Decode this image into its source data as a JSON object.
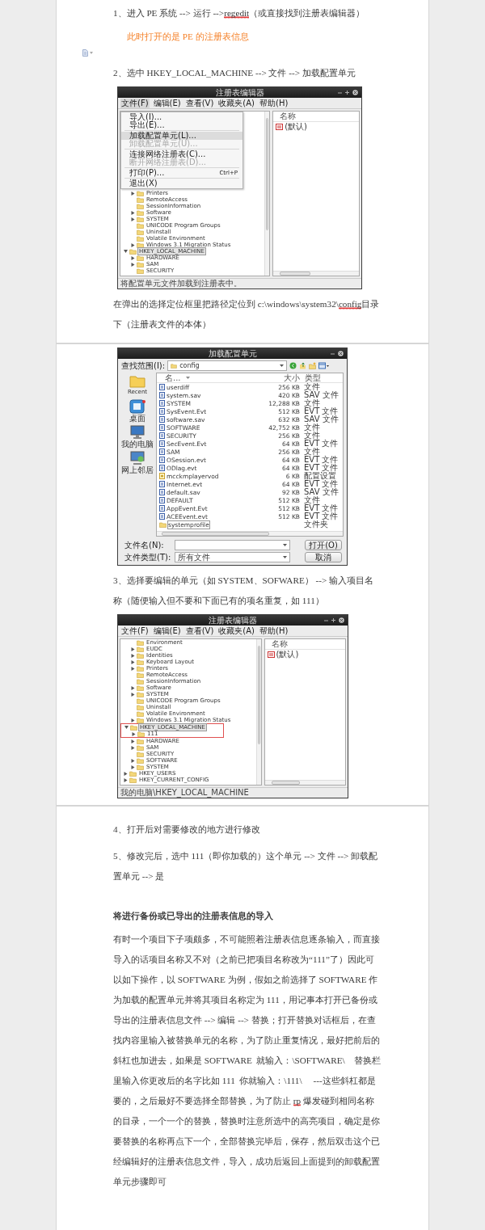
{
  "pages": [
    {
      "blocks": [
        {
          "kind": "paragraph",
          "segments": [
            {
              "text": "1、进入 PE 系统 --> 运行 -->",
              "flagged": false
            },
            {
              "text": "regedit",
              "flagged": true
            },
            {
              "text": "（或直接找到注册表编辑器）",
              "flagged": false
            }
          ]
        },
        {
          "kind": "note",
          "text": "此时打开的是 PE 的注册表信息"
        },
        {
          "kind": "anchor"
        },
        {
          "kind": "paragraph",
          "segments": [
            {
              "text": "2、选中 HKEY_LOCAL_MACHINE --> 文件 --> 加载配置单元",
              "flagged": false
            }
          ]
        },
        {
          "kind": "registry_editor",
          "title": "注册表编辑器",
          "menu": [
            {
              "label": "文件(F)",
              "selected": true
            },
            {
              "label": "编辑(E)",
              "selected": false
            },
            {
              "label": "查看(V)",
              "selected": false
            },
            {
              "label": "收藏夹(A)",
              "selected": false
            },
            {
              "label": "帮助(H)",
              "selected": false
            }
          ],
          "open_menu": [
            {
              "kind": "item",
              "label": "导入(I)...",
              "selected": false,
              "disabled": false
            },
            {
              "kind": "item",
              "label": "导出(E)...",
              "selected": false,
              "disabled": false
            },
            {
              "kind": "separator"
            },
            {
              "kind": "item",
              "label": "加载配置单元(L)...",
              "selected": true,
              "disabled": false
            },
            {
              "kind": "item",
              "label": "卸载配置单元(U)...",
              "selected": false,
              "disabled": true
            },
            {
              "kind": "separator"
            },
            {
              "kind": "item",
              "label": "连接网络注册表(C)...",
              "selected": false,
              "disabled": false
            },
            {
              "kind": "item",
              "label": "断开网络注册表(D)...",
              "selected": false,
              "disabled": true
            },
            {
              "kind": "separator"
            },
            {
              "kind": "item",
              "label": "打印(P)...",
              "shortcut": "Ctrl+P",
              "selected": false,
              "disabled": false
            },
            {
              "kind": "separator"
            },
            {
              "kind": "item",
              "label": "退出(X)",
              "selected": false,
              "disabled": false
            }
          ],
          "tree": [
            {
              "children": [
                {
                  "label": "Printers",
                  "expandable": true,
                  "expanded": false,
                  "selected": false
                },
                {
                  "label": "RemoteAccess",
                  "expandable": false,
                  "selected": false
                },
                {
                  "label": "SessionInformation",
                  "expandable": false,
                  "selected": false
                },
                {
                  "label": "Software",
                  "expandable": true,
                  "expanded": false,
                  "selected": false
                },
                {
                  "label": "SYSTEM",
                  "expandable": true,
                  "expanded": false,
                  "selected": false
                },
                {
                  "label": "UNICODE Program Groups",
                  "expandable": false,
                  "selected": false
                },
                {
                  "label": "Uninstall",
                  "expandable": false,
                  "selected": false
                },
                {
                  "label": "Volatile Environment",
                  "expandable": false,
                  "selected": false
                },
                {
                  "label": "Windows 3.1 Migration Status",
                  "expandable": true,
                  "expanded": false,
                  "selected": false
                }
              ]
            },
            {
              "label": "HKEY_LOCAL_MACHINE",
              "expandable": true,
              "expanded": true,
              "selected": true,
              "children": [
                {
                  "label": "HARDWARE",
                  "expandable": true,
                  "expanded": false,
                  "selected": false
                },
                {
                  "label": "SAM",
                  "expandable": true,
                  "expanded": false,
                  "selected": false
                },
                {
                  "label": "SECURITY",
                  "expandable": false,
                  "selected": false
                }
              ]
            }
          ],
          "value_header": "名称",
          "values": [
            "(默认)"
          ],
          "status": "将配置单元文件加载到注册表中。"
        },
        {
          "kind": "paragraph",
          "segments": [
            {
              "text": "在弹出的选择定位框里把路径定位到 c:\\windows\\system32\\",
              "flagged": false
            },
            {
              "text": "config",
              "flagged": true
            },
            {
              "text": "目录下（注册表文件的本体）",
              "flagged": false
            }
          ]
        }
      ]
    },
    {
      "blocks": [
        {
          "kind": "open_dialog",
          "title": "加载配置单元",
          "look_in_label": "查找范围(I):",
          "look_in": "config",
          "places": [
            {
              "kind": "recent",
              "label": "Recent"
            },
            {
              "kind": "desktop",
              "label": "桌面"
            },
            {
              "kind": "computer",
              "label": "我的电脑"
            },
            {
              "kind": "network",
              "label": "网上邻居"
            }
          ],
          "columns": [
            "名...",
            "大小",
            "类型"
          ],
          "files": [
            {
              "kind": "file",
              "name": "userdiff",
              "size": "256 KB",
              "type": "文件",
              "selected": false
            },
            {
              "kind": "file",
              "name": "system.sav",
              "size": "420 KB",
              "type": "SAV 文件",
              "selected": false
            },
            {
              "kind": "file",
              "name": "SYSTEM",
              "size": "12,288 KB",
              "type": "文件",
              "selected": false
            },
            {
              "kind": "file",
              "name": "SysEvent.Evt",
              "size": "512 KB",
              "type": "EVT 文件",
              "selected": false
            },
            {
              "kind": "file",
              "name": "software.sav",
              "size": "632 KB",
              "type": "SAV 文件",
              "selected": false
            },
            {
              "kind": "file",
              "name": "SOFTWARE",
              "size": "42,752 KB",
              "type": "文件",
              "selected": false
            },
            {
              "kind": "file",
              "name": "SECURITY",
              "size": "256 KB",
              "type": "文件",
              "selected": false
            },
            {
              "kind": "file",
              "name": "SecEvent.Evt",
              "size": "64 KB",
              "type": "EVT 文件",
              "selected": false
            },
            {
              "kind": "file",
              "name": "SAM",
              "size": "256 KB",
              "type": "文件",
              "selected": false
            },
            {
              "kind": "file",
              "name": "OSession.evt",
              "size": "64 KB",
              "type": "EVT 文件",
              "selected": false
            },
            {
              "kind": "file",
              "name": "ODlag.evt",
              "size": "64 KB",
              "type": "EVT 文件",
              "selected": false
            },
            {
              "kind": "settings",
              "name": "mcckmplayervod",
              "size": "6 KB",
              "type": "配置设置",
              "selected": false
            },
            {
              "kind": "file",
              "name": "Internet.evt",
              "size": "64 KB",
              "type": "EVT 文件",
              "selected": false
            },
            {
              "kind": "file",
              "name": "default.sav",
              "size": "92 KB",
              "type": "SAV 文件",
              "selected": false
            },
            {
              "kind": "file",
              "name": "DEFAULT",
              "size": "512 KB",
              "type": "文件",
              "selected": false
            },
            {
              "kind": "file",
              "name": "AppEvent.Evt",
              "size": "512 KB",
              "type": "EVT 文件",
              "selected": false
            },
            {
              "kind": "file",
              "name": "ACEEvent.evt",
              "size": "512 KB",
              "type": "EVT 文件",
              "selected": false
            },
            {
              "kind": "folder",
              "name": "systemprofile",
              "type": "文件夹",
              "selected": true
            }
          ],
          "file_name_label": "文件名(N):",
          "file_type_label": "文件类型(T):",
          "file_type": "所有文件",
          "buttons": [
            "打开(O)",
            "取消"
          ]
        },
        {
          "kind": "paragraph",
          "segments": [
            {
              "text": "3、选择要编辑的单元（如 SYSTEM、SOFWARE） --> 输入项目名称（随便输入但不要和下面已有的项名重复，如 111）",
              "flagged": false
            }
          ]
        },
        {
          "kind": "registry_editor",
          "title": "注册表编辑器",
          "menu": [
            {
              "label": "文件(F)",
              "selected": false
            },
            {
              "label": "编辑(E)",
              "selected": false
            },
            {
              "label": "查看(V)",
              "selected": false
            },
            {
              "label": "收藏夹(A)",
              "selected": false
            },
            {
              "label": "帮助(H)",
              "selected": false
            }
          ],
          "tree": [
            {
              "children": [
                {
                  "label": "Environment",
                  "expandable": false,
                  "selected": false
                },
                {
                  "label": "EUDC",
                  "expandable": true,
                  "expanded": false,
                  "selected": false
                },
                {
                  "label": "Identities",
                  "expandable": true,
                  "expanded": false,
                  "selected": false
                },
                {
                  "label": "Keyboard Layout",
                  "expandable": true,
                  "expanded": false,
                  "selected": false
                },
                {
                  "label": "Printers",
                  "expandable": true,
                  "expanded": false,
                  "selected": false
                },
                {
                  "label": "RemoteAccess",
                  "expandable": false,
                  "selected": false
                },
                {
                  "label": "SessionInformation",
                  "expandable": false,
                  "selected": false
                },
                {
                  "label": "Software",
                  "expandable": true,
                  "expanded": false,
                  "selected": false
                },
                {
                  "label": "SYSTEM",
                  "expandable": true,
                  "expanded": false,
                  "selected": false
                },
                {
                  "label": "UNICODE Program Groups",
                  "expandable": false,
                  "selected": false
                },
                {
                  "label": "Uninstall",
                  "expandable": false,
                  "selected": false
                },
                {
                  "label": "Volatile Environment",
                  "expandable": false,
                  "selected": false
                },
                {
                  "label": "Windows 3.1 Migration Status",
                  "expandable": true,
                  "expanded": false,
                  "selected": false
                }
              ]
            },
            {
              "label": "HKEY_LOCAL_MACHINE",
              "expandable": true,
              "expanded": true,
              "selected": true,
              "framed": true,
              "children": [
                {
                  "label": "111",
                  "expandable": true,
                  "expanded": false,
                  "selected": false
                },
                {
                  "label": "HARDWARE",
                  "expandable": true,
                  "expanded": false,
                  "selected": false
                },
                {
                  "label": "SAM",
                  "expandable": true,
                  "expanded": false,
                  "selected": false
                },
                {
                  "label": "SECURITY",
                  "expandable": false,
                  "selected": false
                },
                {
                  "label": "SOFTWARE",
                  "expandable": true,
                  "expanded": false,
                  "selected": false
                },
                {
                  "label": "SYSTEM",
                  "expandable": true,
                  "expanded": false,
                  "selected": false
                }
              ]
            },
            {
              "label": "HKEY_USERS",
              "expandable": true,
              "expanded": false,
              "selected": false
            },
            {
              "label": "HKEY_CURRENT_CONFIG",
              "expandable": true,
              "expanded": false,
              "selected": false
            }
          ],
          "value_header": "名称",
          "values": [
            "(默认)"
          ],
          "status": "我的电脑\\HKEY_LOCAL_MACHINE"
        }
      ]
    },
    {
      "blocks": [
        {
          "kind": "paragraph",
          "segments": [
            {
              "text": "4、打开后对需要修改的地方进行修改",
              "flagged": false
            }
          ]
        },
        {
          "kind": "paragraph",
          "segments": [
            {
              "text": "5、修改完后，选中 111（即你加载的）这个单元 --> 文件 --> 卸载配置单元 --> 是",
              "flagged": false
            }
          ]
        },
        {
          "kind": "heading",
          "text": "将进行备份或已导出的注册表信息的导入"
        },
        {
          "kind": "paragraph",
          "segments": [
            {
              "text": "有时一个项目下子项颇多，不可能照着注册表信息逐条输入，而直接导入的话项目名称又不对（之前已把项目名称改为“111”了）因此可以如下操作，以 SOFTWARE 为例，假如之前选择了 SOFTWARE 作为加载的配置单元并将其项目名称定为 111，用记事本打开已备份或导出的注册表信息文件 --> 编辑 --> 替换；打开替换对话框后，在查找内容里输入被替换单元的名称，为了防止重复情况，最好把前后的斜杠也加进去，如果是 SOFTWARE  就输入：\\SOFTWARE\\    替换栏里输入你更改后的名字比如 111  你就输入：\\111\\     ---这些斜杠都是要的，之后最好不要选择全部替换，为了防止 ",
              "flagged": false
            },
            {
              "text": "rp",
              "flagged": true
            },
            {
              "text": " 爆发碰到相同名称的目录，一个一个的替换，替换时注意所选中的高亮项目，确定是你要替换的名称再点下一个，全部替换完毕后，保存，然后双击这个已经编辑好的注册表信息文件，导入，成功后返回上面提到的卸载配置单元步骤即可",
              "flagged": false
            }
          ]
        }
      ]
    }
  ]
}
